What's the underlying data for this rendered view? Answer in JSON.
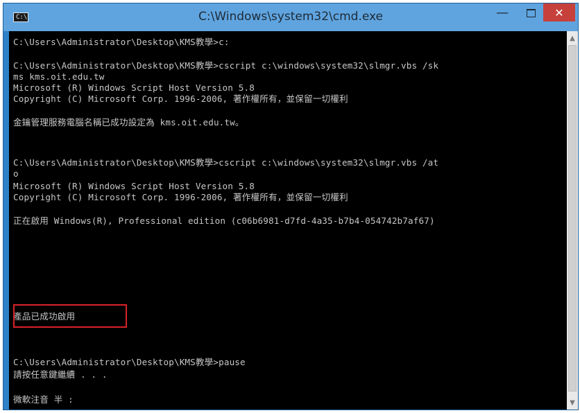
{
  "window": {
    "title": "C:\\Windows\\system32\\cmd.exe",
    "icon_glyph": "C:\\",
    "minimize_glyph": "—",
    "close_glyph": "✕"
  },
  "console_lines": [
    "C:\\Users\\Administrator\\Desktop\\KMS教學>c:",
    "C:\\Users\\Administrator\\Desktop\\KMS教學>cscript c:\\windows\\system32\\slmgr.vbs /sk",
    "ms kms.oit.edu.tw",
    "Microsoft (R) Windows Script Host Version 5.8",
    "Copyright (C) Microsoft Corp. 1996-2006, 著作權所有，並保留一切權利",
    "金鑰管理服務電腦名稱已成功設定為 kms.oit.edu.tw。",
    "C:\\Users\\Administrator\\Desktop\\KMS教學>cscript c:\\windows\\system32\\slmgr.vbs /at",
    "o",
    "Microsoft (R) Windows Script Host Version 5.8",
    "Copyright (C) Microsoft Corp. 1996-2006, 著作權所有，並保留一切權利",
    "正在啟用 Windows(R), Professional edition (c06b6981-d7fd-4a35-b7b4-054742b7af67)",
    "產品已成功啟用",
    "C:\\Users\\Administrator\\Desktop\\KMS教學>pause",
    "請按任意鍵繼續 . . .",
    "微軟注音 半 :"
  ],
  "scrollbar": {
    "up_glyph": "▲",
    "down_glyph": "▼"
  }
}
